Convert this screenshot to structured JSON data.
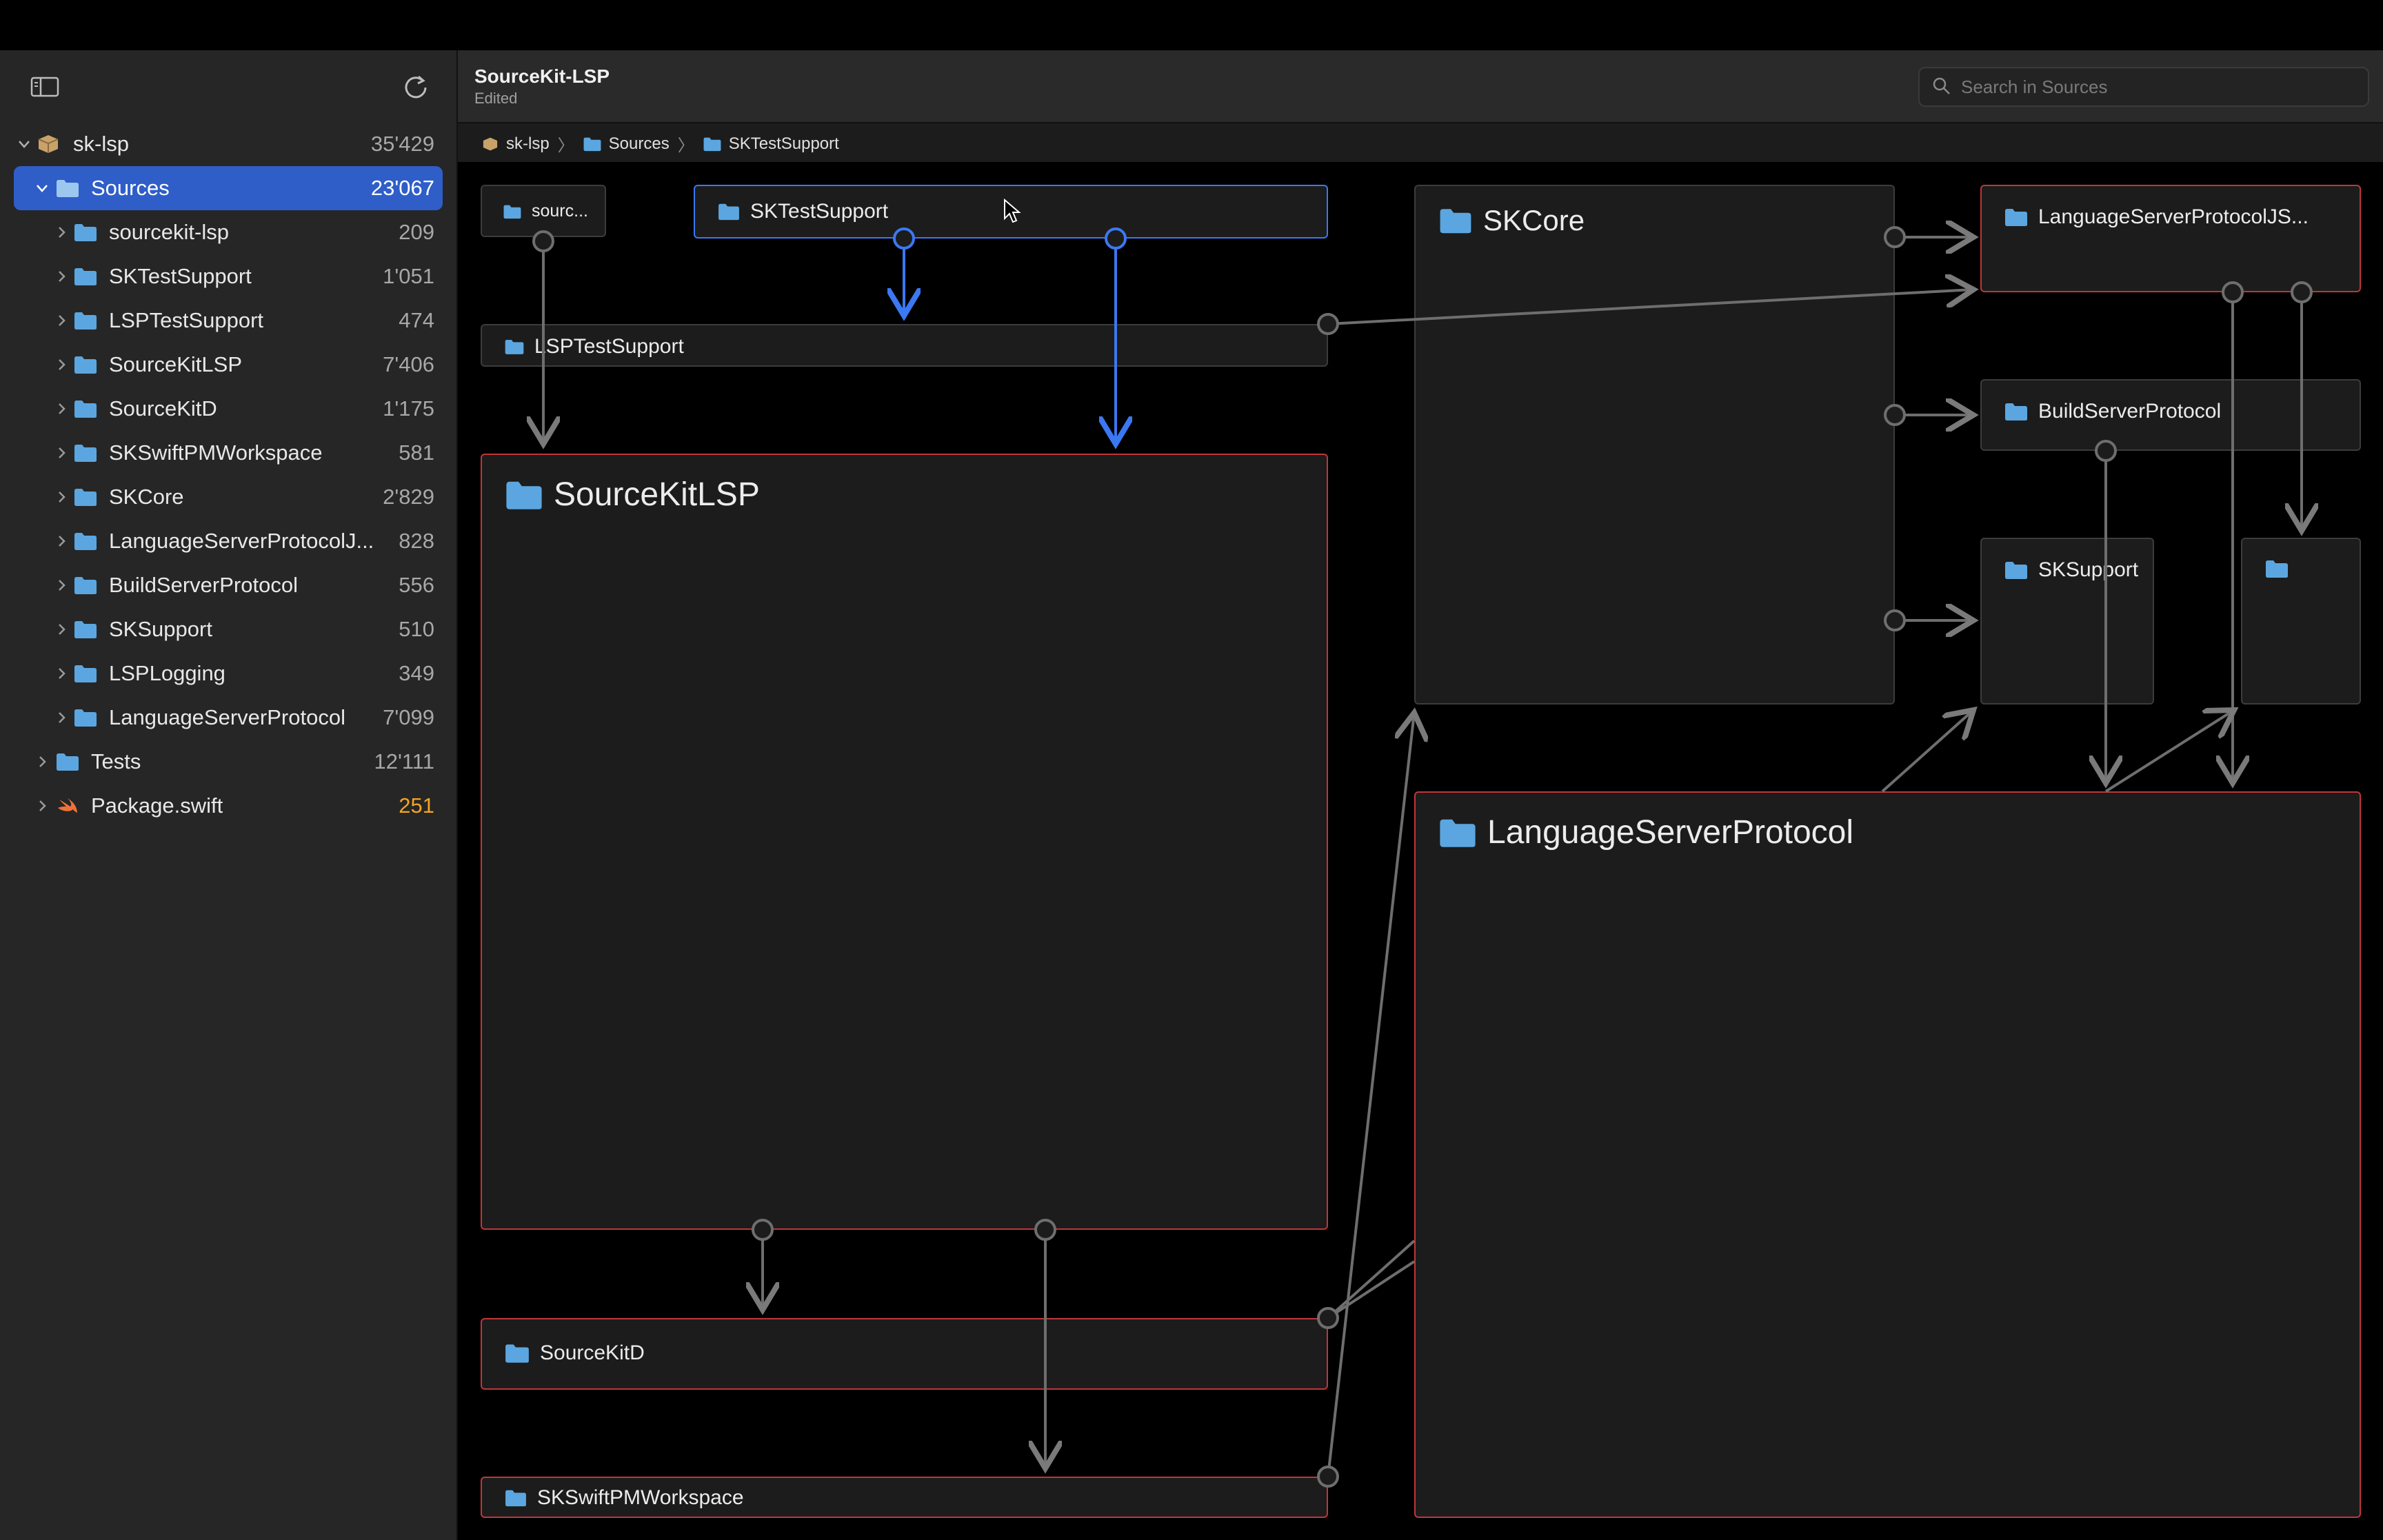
{
  "window": {
    "title": "SourceKit-LSP",
    "subtitle": "Edited"
  },
  "search": {
    "placeholder": "Search in Sources"
  },
  "breadcrumb": [
    "sk-lsp",
    "Sources",
    "SKTestSupport"
  ],
  "sidebar": {
    "root": {
      "label": "sk-lsp",
      "count": "35'429"
    },
    "sources": {
      "label": "Sources",
      "count": "23'067"
    },
    "items": [
      {
        "label": "sourcekit-lsp",
        "count": "209"
      },
      {
        "label": "SKTestSupport",
        "count": "1'051"
      },
      {
        "label": "LSPTestSupport",
        "count": "474"
      },
      {
        "label": "SourceKitLSP",
        "count": "7'406"
      },
      {
        "label": "SourceKitD",
        "count": "1'175"
      },
      {
        "label": "SKSwiftPMWorkspace",
        "count": "581"
      },
      {
        "label": "SKCore",
        "count": "2'829"
      },
      {
        "label": "LanguageServerProtocolJ...",
        "count": "828"
      },
      {
        "label": "BuildServerProtocol",
        "count": "556"
      },
      {
        "label": "SKSupport",
        "count": "510"
      },
      {
        "label": "LSPLogging",
        "count": "349"
      },
      {
        "label": "LanguageServerProtocol",
        "count": "7'099"
      }
    ],
    "tests": {
      "label": "Tests",
      "count": "12'111"
    },
    "package": {
      "label": "Package.swift",
      "count": "251"
    }
  },
  "graph": {
    "sourcekit_lsp": "sourc...",
    "sktestsupport": "SKTestSupport",
    "lsptestsupport": "LSPTestSupport",
    "sourcekitlsp": "SourceKitLSP",
    "sourcekitd": "SourceKitD",
    "skswiftpmworkspace": "SKSwiftPMWorkspace",
    "skcore": "SKCore",
    "lsp_json": "LanguageServerProtocolJS...",
    "bsp": "BuildServerProtocol",
    "sksupport": "SKSupport",
    "lsplogging": "",
    "lsp": "LanguageServerProtocol"
  },
  "colors": {
    "accent": "#2f5ec9",
    "folder": "#5ba6e0",
    "error_border": "#c0363a",
    "selected_border": "#3b78f2",
    "count_warning": "#f5a524"
  }
}
